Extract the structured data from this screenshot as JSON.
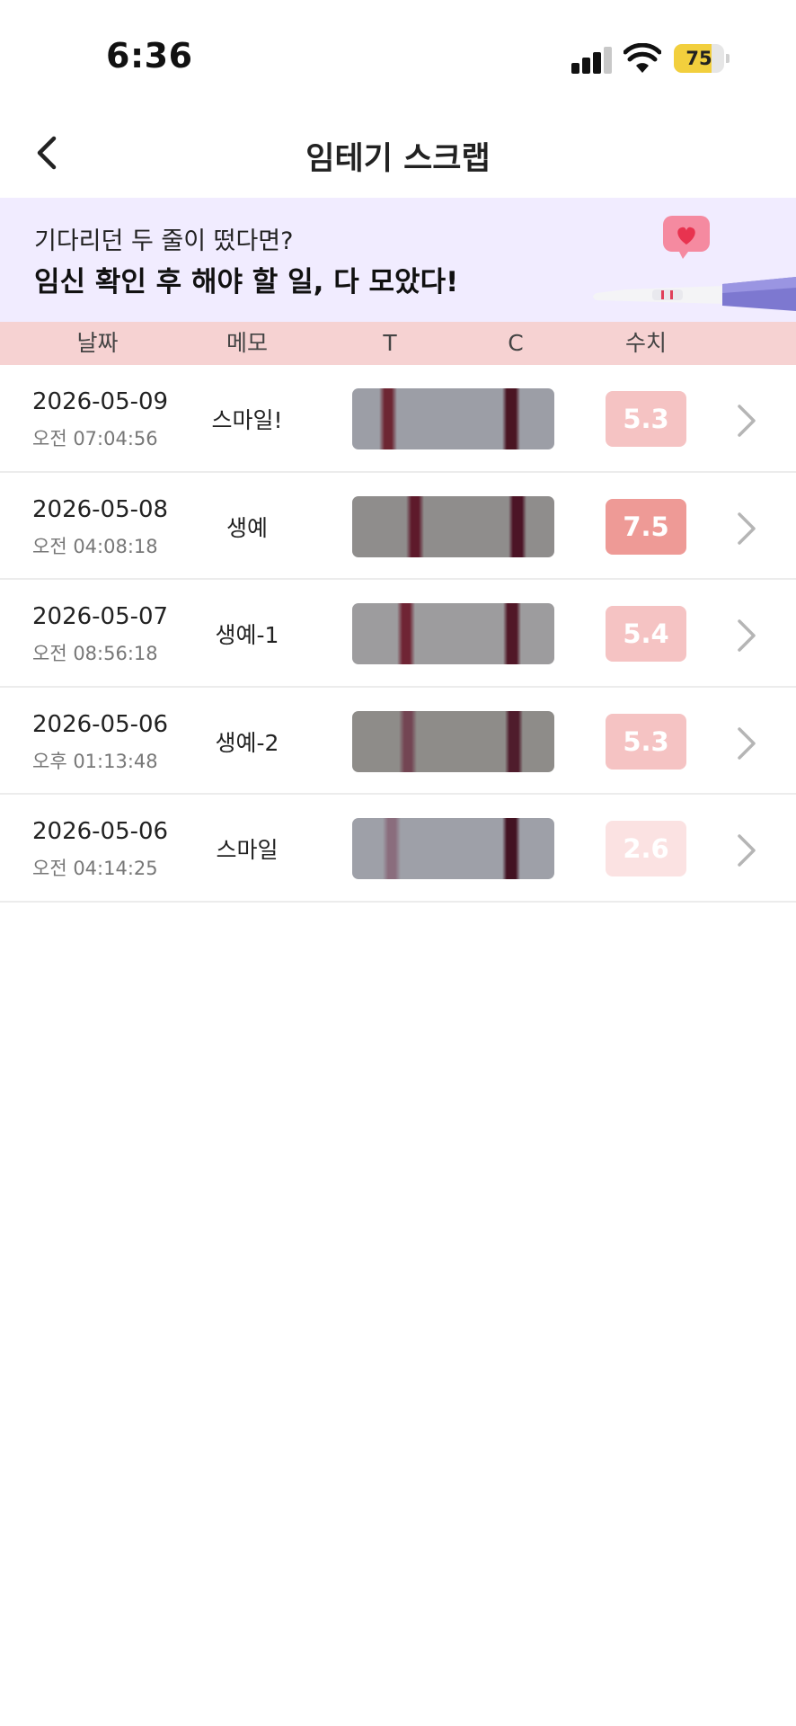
{
  "status_bar": {
    "time": "6:36",
    "battery": "75",
    "battery_level": 0.75
  },
  "nav": {
    "title": "임테기 스크랩",
    "back_icon": "chevron-left-icon"
  },
  "banner": {
    "subtitle": "기다리던 두 줄이 떴다면?",
    "headline": "임신 확인 후 해야 할 일, 다 모았다!",
    "background": "#f1ecff"
  },
  "table": {
    "headers": [
      "날짜",
      "메모",
      "T",
      "C",
      "수치"
    ],
    "header_background": "#f6d2d2",
    "rows": [
      {
        "date": "2026-05-09",
        "time": "오전 07:04:56",
        "memo": "스마일!",
        "value": "5.3",
        "badge_color": "#f5c3c3",
        "strip_color": "#9c9ea6",
        "t_line": "#6d2633",
        "c_line": "#4a1422"
      },
      {
        "date": "2026-05-08",
        "time": "오전 04:08:18",
        "memo": "생예",
        "value": "7.5",
        "badge_color": "#ee9a96",
        "strip_color": "#8f8d8c",
        "t_line": "#5e1a2b",
        "c_line": "#4c1426"
      },
      {
        "date": "2026-05-07",
        "time": "오전 08:56:18",
        "memo": "생예-1",
        "value": "5.4",
        "badge_color": "#f5c3c3",
        "strip_color": "#9d9c9e",
        "t_line": "#6f2434",
        "c_line": "#511727"
      },
      {
        "date": "2026-05-06",
        "time": "오후 01:13:48",
        "memo": "생예-2",
        "value": "5.3",
        "badge_color": "#f5c3c3",
        "strip_color": "#8e8c89",
        "t_line": "#734553",
        "c_line": "#4f1c2c"
      },
      {
        "date": "2026-05-06",
        "time": "오전 04:14:25",
        "memo": "스마일",
        "value": "2.6",
        "badge_color": "#fbe2e2",
        "strip_color": "#9ea0a8",
        "t_line": "#8a6d7d",
        "c_line": "#431222"
      }
    ]
  }
}
